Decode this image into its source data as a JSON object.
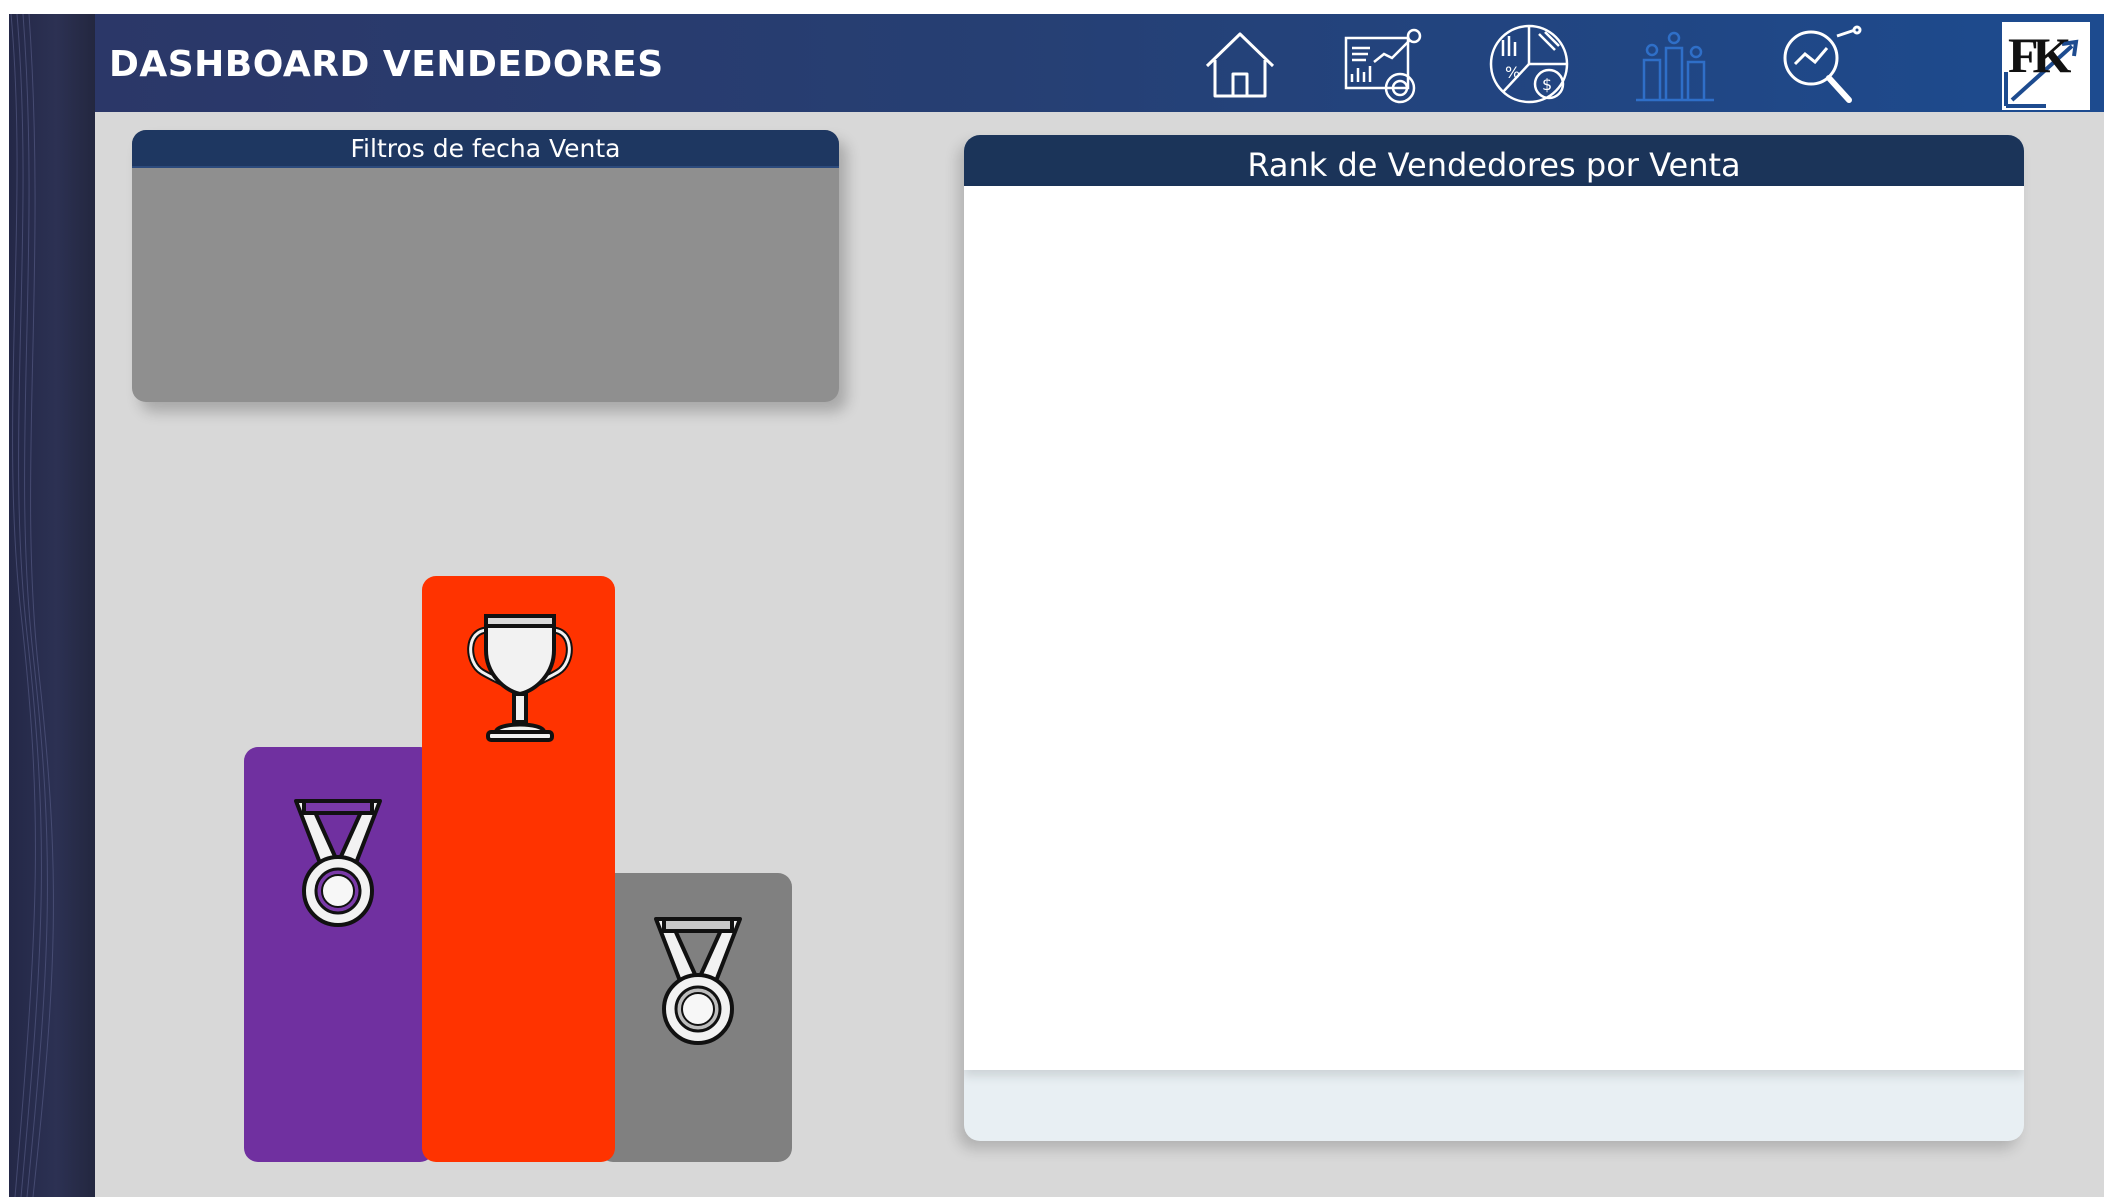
{
  "header": {
    "title": "DASHBOARD VENDEDORES",
    "nav_icons": [
      "home-icon",
      "report-chart-icon",
      "finance-pie-icon",
      "people-bars-icon",
      "search-analytics-icon"
    ],
    "logo_text": "FK"
  },
  "filter_panel": {
    "title": "Filtros de fecha Venta"
  },
  "rank_panel": {
    "title": "Rank de Vendedores por Venta"
  },
  "podium": {
    "first": {
      "icon": "trophy-icon",
      "color": "#ff3300"
    },
    "second": {
      "icon": "medal-icon",
      "color": "#7030a0"
    },
    "third": {
      "icon": "medal-icon",
      "color": "#808080"
    }
  },
  "colors": {
    "header_bg": "#263f73",
    "panel_header": "#1b3459",
    "background": "#d8d8d8"
  }
}
